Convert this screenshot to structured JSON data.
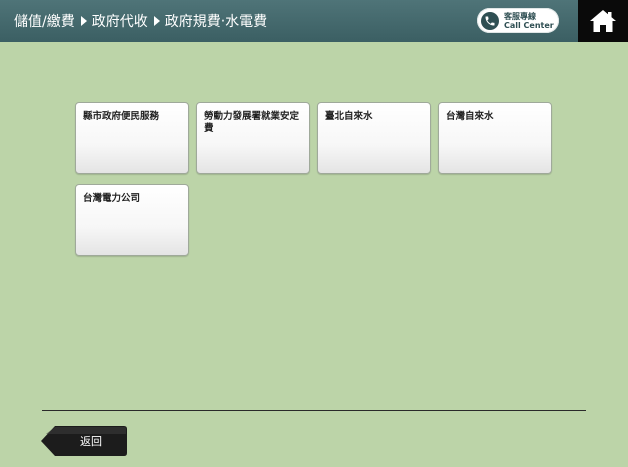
{
  "header": {
    "breadcrumb": [
      "儲值/繳費",
      "政府代收",
      "政府規費‧水電費"
    ],
    "call_center": {
      "line1": "客服專線",
      "line2": "Call Center"
    }
  },
  "tiles": [
    {
      "label": "縣市政府便民服務"
    },
    {
      "label": "勞動力發展署就業安定費"
    },
    {
      "label": "臺北自來水"
    },
    {
      "label": "台灣自來水"
    },
    {
      "label": "台灣電力公司"
    }
  ],
  "footer": {
    "back_label": "返回"
  },
  "colors": {
    "background": "#bcd4a8",
    "header": "#3f6468",
    "home": "#0a0a0a",
    "back_button": "#1c1c1c"
  },
  "icons": {
    "call_center": "phone-icon",
    "home": "home-icon",
    "back": "back-arrow-icon"
  }
}
